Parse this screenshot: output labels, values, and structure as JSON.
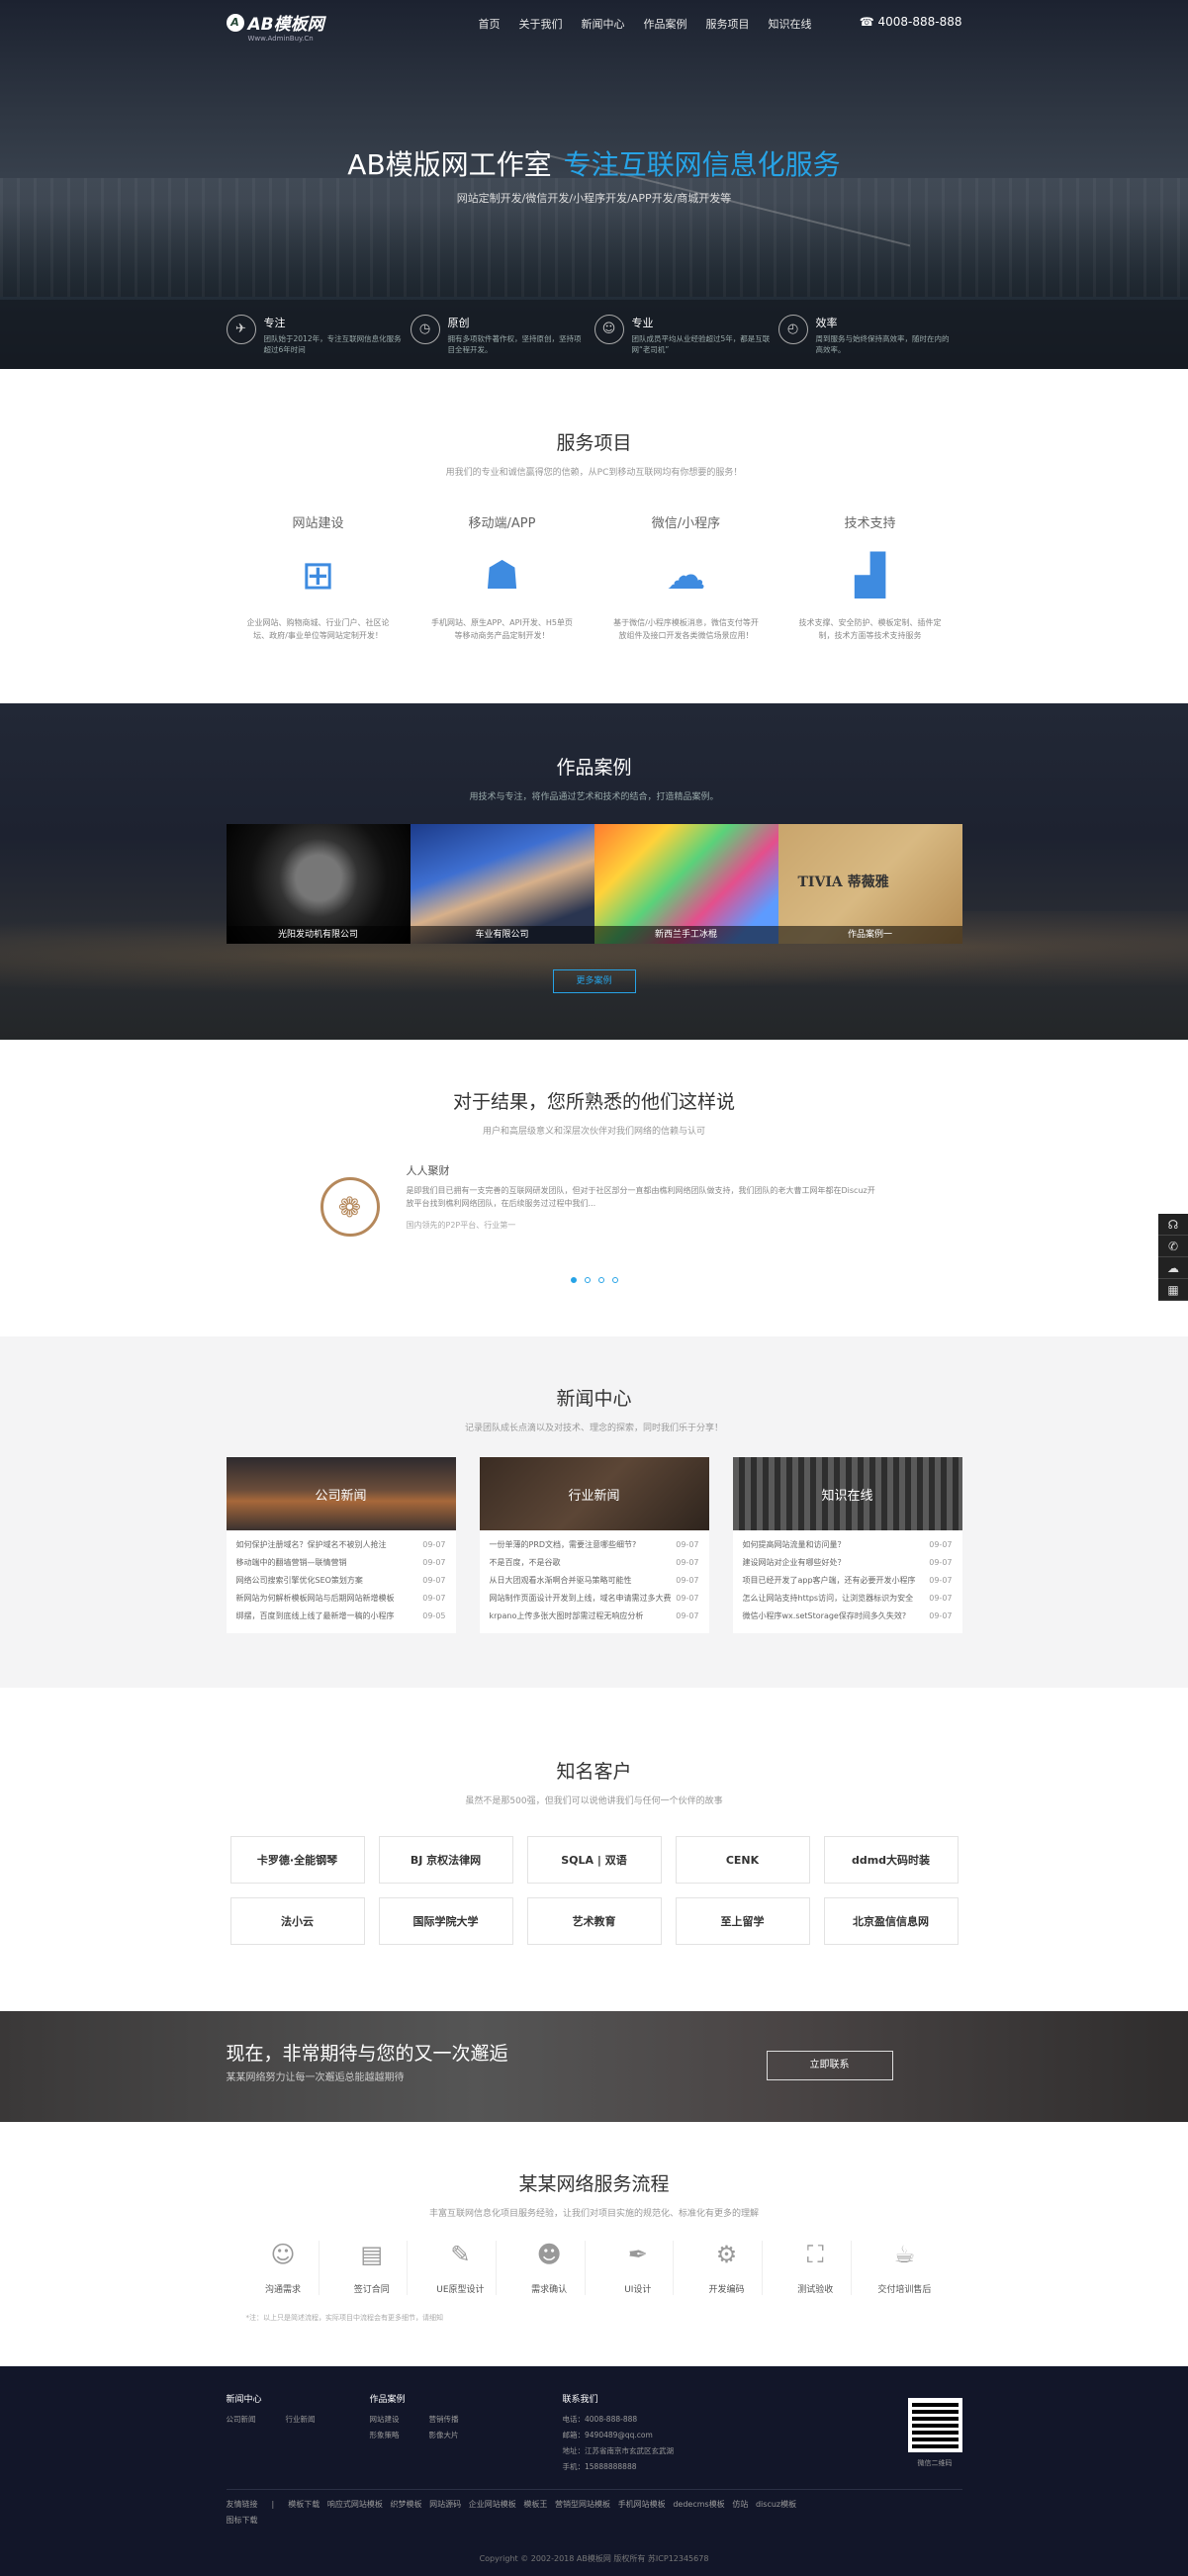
{
  "header": {
    "logo": "AB模板网",
    "logo_sub": "Www.AdminBuy.Cn",
    "nav": [
      "首页",
      "关于我们",
      "新闻中心",
      "作品案例",
      "服务项目",
      "知识在线"
    ],
    "phone": "4008-888-888",
    "title_main": "AB模版网工作室",
    "title_highlight": "专注互联网信息化服务",
    "subtitle": "网站定制开发/微信开发/小程序开发/APP开发/商城开发等"
  },
  "features": [
    {
      "title": "专注",
      "desc": "团队始于2012年，专注互联网信息化服务超过6年时间",
      "icon": "compass-icon"
    },
    {
      "title": "原创",
      "desc": "拥有多项软件著作权，坚持原创，坚持项目全程开发。",
      "icon": "clock-icon"
    },
    {
      "title": "专业",
      "desc": "团队成员平均从业经验超过5年，都是互联网“老司机”",
      "icon": "user-icon"
    },
    {
      "title": "效率",
      "desc": "周到服务与始终保持高效率，随时在内的高效率。",
      "icon": "clock-icon"
    }
  ],
  "services": {
    "title": "服务项目",
    "subtitle": "用我们的专业和诚信赢得您的信赖，从PC到移动互联网均有你想要的服务！",
    "items": [
      {
        "title": "网站建设",
        "desc": "企业网站、购物商城、行业门户、社区论坛、政府/事业单位等网站定制开发！",
        "icon": "windows-icon"
      },
      {
        "title": "移动端/APP",
        "desc": "手机网站、原生APP、API开发、H5单页等移动商务产品定制开发！",
        "icon": "android-icon"
      },
      {
        "title": "微信/小程序",
        "desc": "基于微信/小程序模板消息，微信支付等开放组件及接口开发各类微信场景应用！",
        "icon": "wechat-icon"
      },
      {
        "title": "技术支持",
        "desc": "技术支撑、安全防护、模板定制、插件定制，技术方面等技术支持服务",
        "icon": "chart-icon"
      }
    ]
  },
  "cases": {
    "title": "作品案例",
    "subtitle": "用技术与专注，将作品通过艺术和技术的结合，打造精品案例。",
    "items": [
      "光阳发动机有限公司",
      "车业有限公司",
      "新西兰手工冰棍",
      "作品案例一"
    ],
    "brand_text": "TIVIA 蒂薇雅",
    "more": "更多案例"
  },
  "testimonial": {
    "title": "对于结果，您所熟悉的他们这样说",
    "subtitle": "用户和高层级意义和深层次伙伴对我们网络的信赖与认可",
    "name": "人人聚财",
    "text": "是即我们目已拥有一支完善的互联网研发团队，但对于社区部分一直都由樵利网络团队做支持，我们团队的老大曹工网年都在Discuz开放平台找到樵利网络团队，在后续服务过过程中我们...",
    "more": "国内领先的P2P平台、行业第一",
    "dots": 4,
    "active_dot": 0
  },
  "float_bar": [
    "headset-icon",
    "phone-icon",
    "wechat-icon",
    "qrcode-icon"
  ],
  "news": {
    "title": "新闻中心",
    "subtitle": "记录团队成长点滴以及对技术、理念的探索，同时我们乐于分享！",
    "columns": [
      {
        "label": "公司新闻",
        "items": [
          {
            "t": "如何保护注册域名？保护域名不被别人抢注",
            "d": "09-07"
          },
          {
            "t": "移动端中的翻墙营销—联情营销",
            "d": "09-07"
          },
          {
            "t": "网络公司搜索引擎优化SEO策划方案",
            "d": "09-07"
          },
          {
            "t": "新网站为何解析模板网站与后期网站新增模板",
            "d": "09-07"
          },
          {
            "t": "绑摆，百度到底线上线了最新增一稿的小程序",
            "d": "09-05"
          }
        ]
      },
      {
        "label": "行业新闻",
        "items": [
          {
            "t": "一份单薄的PRD文档，需要注意哪些细节?",
            "d": "09-07"
          },
          {
            "t": "不是百度，不是谷歌",
            "d": "09-07"
          },
          {
            "t": "从日大团观看水渐啊合并驱马策略可能性",
            "d": "09-07"
          },
          {
            "t": "网站制作页面设计开发到上线，域名申请需过多大费",
            "d": "09-07"
          },
          {
            "t": "krpano上传多张大图时部需过程无响应分析",
            "d": "09-07"
          }
        ]
      },
      {
        "label": "知识在线",
        "items": [
          {
            "t": "如何提高网站流量和访问量？",
            "d": "09-07"
          },
          {
            "t": "建设网站对企业有哪些好处？",
            "d": "09-07"
          },
          {
            "t": "项目已经开发了app客户端，还有必要开发小程序",
            "d": "09-07"
          },
          {
            "t": "怎么让网站支持https访问，让浏览器标识为安全",
            "d": "09-07"
          },
          {
            "t": "微信小程序wx.setStorage保存时间多久失效?",
            "d": "09-07"
          }
        ]
      }
    ]
  },
  "clients": {
    "title": "知名客户",
    "subtitle": "虽然不是那500强，但我们可以说他讲我们与任何一个伙伴的故事",
    "items": [
      "卡罗德·全能钢琴",
      "BJ 京权法律网",
      "SQLA | 双语",
      "CENK",
      "ddmd大码时装",
      "法小云",
      "国际学院大学",
      "艺术教育",
      "至上留学",
      "北京盈信信息网"
    ]
  },
  "cta": {
    "title": "现在，非常期待与您的又一次邂逅",
    "sub": "某某网络努力让每一次邂逅总能越越期待",
    "btn": "立即联系"
  },
  "process": {
    "title": "某某网络服务流程",
    "subtitle": "丰富互联网信息化项目服务经验，让我们对项目实施的规范化、标准化有更多的理解",
    "steps": [
      {
        "label": "沟通需求",
        "icon": "chat-icon"
      },
      {
        "label": "签订合同",
        "icon": "document-icon"
      },
      {
        "label": "UE原型设计",
        "icon": "edit-icon"
      },
      {
        "label": "需求确认",
        "icon": "users-icon"
      },
      {
        "label": "UI设计",
        "icon": "pen-icon"
      },
      {
        "label": "开发编码",
        "icon": "gear-icon"
      },
      {
        "label": "测试验收",
        "icon": "scan-icon"
      },
      {
        "label": "交付培训售后",
        "icon": "cup-icon"
      }
    ],
    "note": "*注：以上只是简述流程，实际项目中流程会有更多细节，请细知"
  },
  "footer": {
    "news_h": "新闻中心",
    "news_links": [
      "公司新闻",
      "行业新闻"
    ],
    "cases_h": "作品案例",
    "cases_links": [
      "网站建设",
      "营销传播",
      "形象策略",
      "影像大片"
    ],
    "contact_h": "联系我们",
    "contact": [
      "电话：4008-888-888",
      "邮箱：9490489@qq.com",
      "地址：江苏省南京市玄武区玄武湖",
      "手机：15888888888"
    ],
    "qr_label": "微信二维码",
    "links": [
      "友情链接",
      "|",
      "模板下载",
      "响应式网站模板",
      "织梦模板",
      "网站源码",
      "企业网站模板",
      "模板王",
      "营销型网站模板",
      "手机网站模板",
      "dedecms模板",
      "仿站",
      "discuz模板",
      "图标下载"
    ],
    "copyright": "Copyright © 2002-2018 AB模板网 版权所有  苏ICP12345678"
  }
}
